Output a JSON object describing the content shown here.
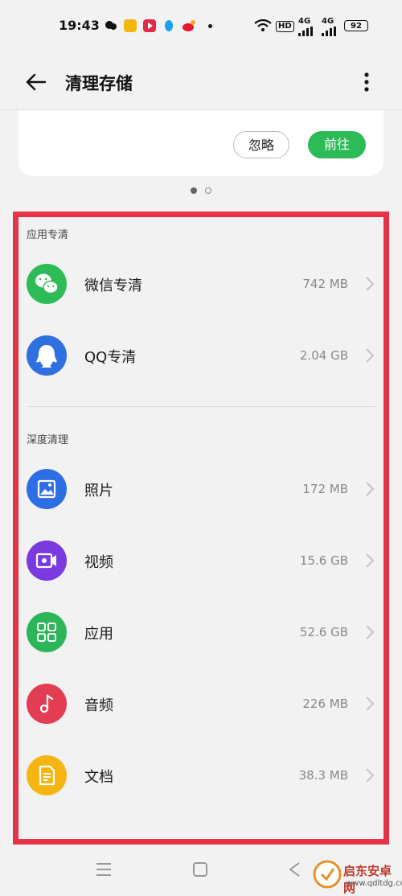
{
  "status_bar": {
    "time": "19:43",
    "hd_label": "HD",
    "network_a": "4G",
    "network_b": "4G",
    "battery": "92"
  },
  "header": {
    "title": "清理存储",
    "back_icon": "arrow-left-icon",
    "more_icon": "more-vertical-icon"
  },
  "top_card": {
    "ignore_label": "忽略",
    "go_label": "前往",
    "accent": "#2dbb57"
  },
  "pager": {
    "active_index": 0,
    "count": 2
  },
  "sections": {
    "app_clean": {
      "label": "应用专清",
      "items": [
        {
          "name": "微信专清",
          "size": "742 MB",
          "icon": "wechat-icon",
          "color": "#2dbb57"
        },
        {
          "name": "QQ专清",
          "size": "2.04 GB",
          "icon": "qq-icon",
          "color": "#2f6fe0"
        }
      ]
    },
    "deep_clean": {
      "label": "深度清理",
      "items": [
        {
          "name": "照片",
          "size": "172 MB",
          "icon": "photo-icon",
          "color": "#2e6ee4"
        },
        {
          "name": "视频",
          "size": "15.6 GB",
          "icon": "video-icon",
          "color": "#7a3ae0"
        },
        {
          "name": "应用",
          "size": "52.6 GB",
          "icon": "apps-grid-icon",
          "color": "#2db55a"
        },
        {
          "name": "音频",
          "size": "226 MB",
          "icon": "music-note-icon",
          "color": "#e23d52"
        },
        {
          "name": "文档",
          "size": "38.3 MB",
          "icon": "document-icon",
          "color": "#f6b512"
        }
      ]
    }
  },
  "highlight_color": "#e63347",
  "watermark": {
    "line1": "启东安卓网",
    "line2": "www.qdltdg.com"
  }
}
